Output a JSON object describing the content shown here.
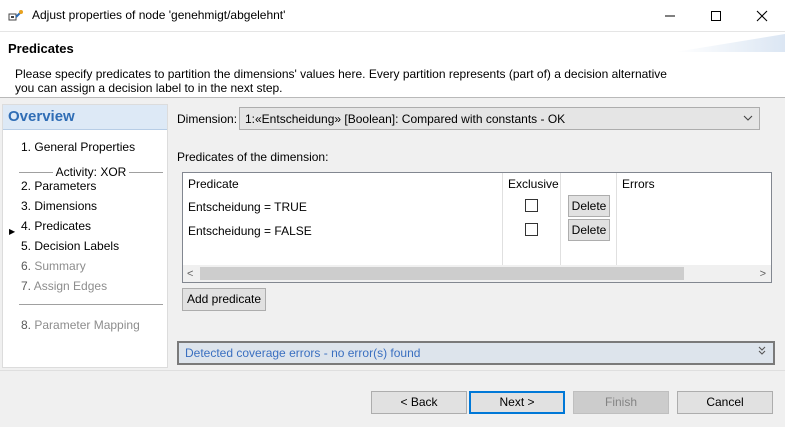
{
  "window": {
    "title": "Adjust properties of node 'genehmigt/abgelehnt'",
    "minimize_icon": "minimize-icon",
    "maximize_icon": "maximize-icon",
    "close_icon": "close-icon"
  },
  "header": {
    "title": "Predicates",
    "description": "Please specify predicates to partition the dimensions' values here. Every partition represents (part of) a decision alternative you can assign a decision label to in the next step."
  },
  "nav": {
    "title": "Overview",
    "group_label": "Activity: XOR",
    "items": [
      {
        "num": "1.",
        "label": "General Properties",
        "enabled": true
      },
      {
        "num": "2.",
        "label": "Parameters",
        "enabled": true
      },
      {
        "num": "3.",
        "label": "Dimensions",
        "enabled": true
      },
      {
        "num": "4.",
        "label": "Predicates",
        "enabled": true,
        "current": true
      },
      {
        "num": "5.",
        "label": "Decision Labels",
        "enabled": true
      },
      {
        "num": "6.",
        "label": "Summary",
        "enabled": false
      },
      {
        "num": "7.",
        "label": "Assign Edges",
        "enabled": false
      },
      {
        "num": "8.",
        "label": "Parameter Mapping",
        "enabled": false
      }
    ]
  },
  "dimension": {
    "label": "Dimension:",
    "selected": "1:«Entscheidung» [Boolean]: Compared with constants  -  OK"
  },
  "predicates": {
    "section_label": "Predicates of the dimension:",
    "columns": [
      "Predicate",
      "Exclusive",
      "",
      "Errors"
    ],
    "rows": [
      {
        "predicate": "Entscheidung = TRUE",
        "exclusive": false,
        "action": "Delete",
        "errors": ""
      },
      {
        "predicate": "Entscheidung = FALSE",
        "exclusive": false,
        "action": "Delete",
        "errors": ""
      }
    ],
    "add_label": "Add predicate"
  },
  "coverage": {
    "text": "Detected coverage errors - no error(s) found",
    "expand_glyph": "»"
  },
  "footer": {
    "back": "< Back",
    "next": "Next >",
    "finish": "Finish",
    "cancel": "Cancel"
  },
  "colors": {
    "nav_title": "#2f6db5",
    "nav_title_bg": "#dde9f6",
    "coverage_text": "#3a6fc0",
    "default_button_border": "#0078d7"
  }
}
